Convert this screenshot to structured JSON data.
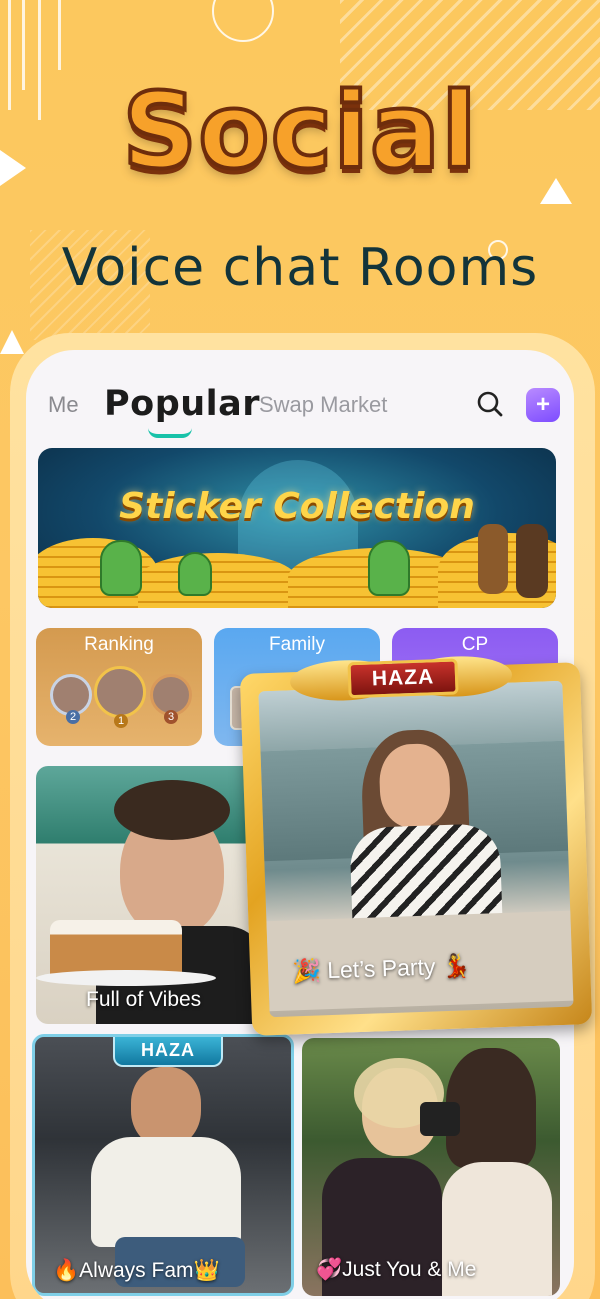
{
  "hero": {
    "title": "Social",
    "subtitle": "Voice chat Rooms"
  },
  "nav": {
    "tabs": [
      {
        "label": "Me"
      },
      {
        "label": "Popular",
        "active": true
      },
      {
        "label": "Swap Market"
      }
    ],
    "search_icon": "search-icon",
    "home_icon": "add-home-icon"
  },
  "banner": {
    "title": "Sticker Collection"
  },
  "cards": [
    {
      "label": "Ranking",
      "ranks": [
        "2",
        "1",
        "3"
      ]
    },
    {
      "label": "Family"
    },
    {
      "label": "CP"
    }
  ],
  "rooms": [
    {
      "label": "Full of Vibes"
    },
    {
      "label": "Let’s Party",
      "badge": "HAZA"
    },
    {
      "label": "Always Fam",
      "badge": "HAZA",
      "emoji_left": "🔥",
      "emoji_right": "👑"
    },
    {
      "label": "Just You & Me",
      "emoji_left": "💞"
    }
  ],
  "colors": {
    "background": "#fcc85e",
    "accent_teal": "#19c2a9",
    "title_orange": "#f7a12a",
    "subtitle_dark": "#13343a"
  }
}
